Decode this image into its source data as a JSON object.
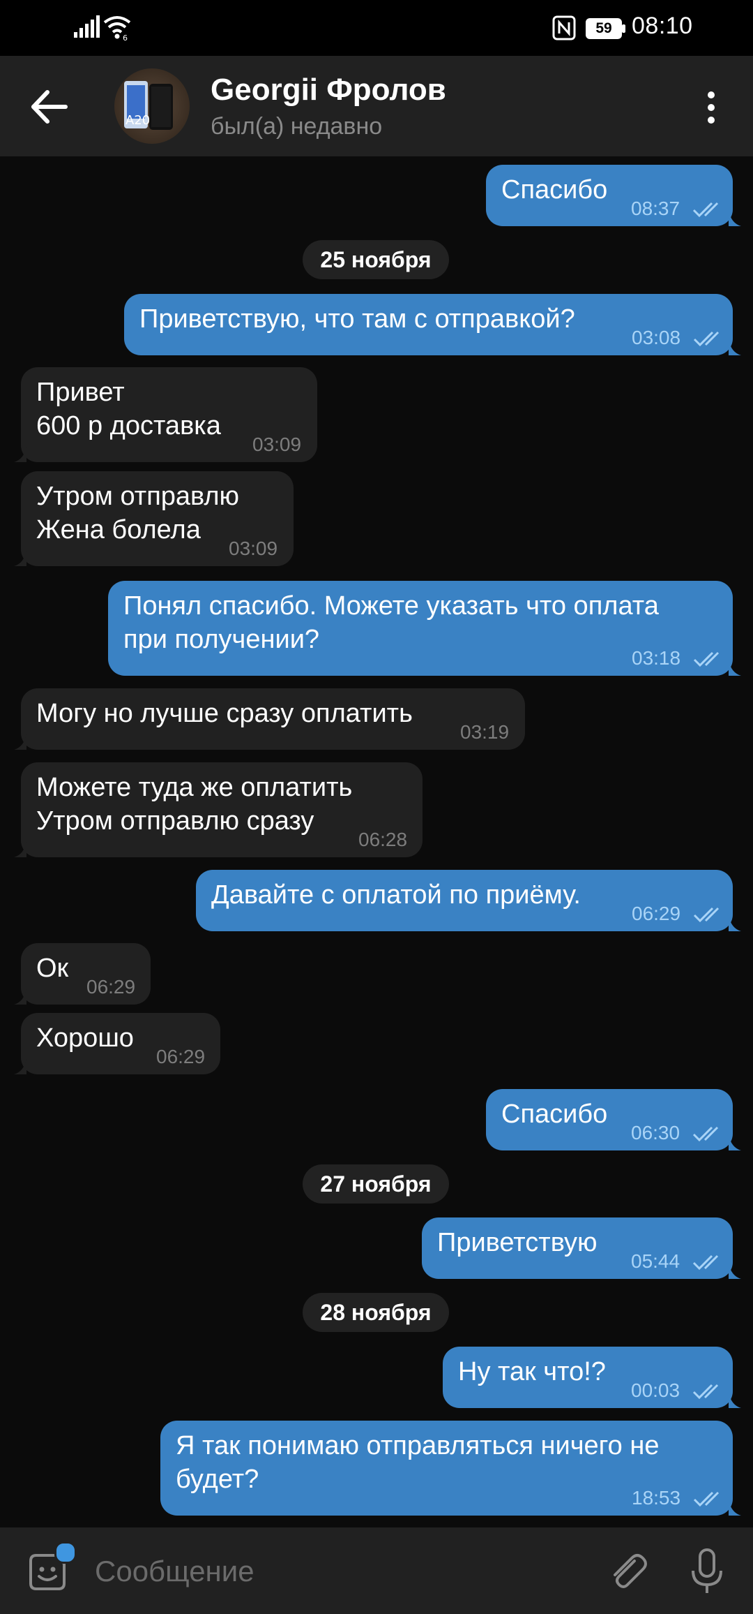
{
  "status_bar": {
    "time": "08:10",
    "battery": "59"
  },
  "header": {
    "contact_name": "Georgii Фролов",
    "contact_status": "был(а) недавно",
    "avatar_text": "A20"
  },
  "messages": [
    {
      "direction": "out",
      "text": "Спасибо",
      "time": "08:37",
      "read": true
    },
    {
      "type": "date",
      "text": "25 ноября"
    },
    {
      "direction": "out",
      "text": "Приветствую, что там с отправкой?",
      "time": "03:08",
      "read": true
    },
    {
      "direction": "in",
      "text": "Привет\n600 р доставка",
      "time": "03:09"
    },
    {
      "direction": "in",
      "text": "Утром отправлю\nЖена болела",
      "time": "03:09"
    },
    {
      "direction": "out",
      "text": "Понял спасибо. Можете указать что оплата\nпри получении?",
      "time": "03:18",
      "read": true
    },
    {
      "direction": "in",
      "text": "Могу но лучше сразу оплатить",
      "time": "03:19"
    },
    {
      "direction": "in",
      "text": "Можете туда же оплатить\nУтром отправлю сразу",
      "time": "06:28"
    },
    {
      "direction": "out",
      "text": "Давайте с оплатой по приёму.",
      "time": "06:29",
      "read": true
    },
    {
      "direction": "in",
      "text": "Ок",
      "time": "06:29"
    },
    {
      "direction": "in",
      "text": "Хорошо",
      "time": "06:29"
    },
    {
      "direction": "out",
      "text": "Спасибо",
      "time": "06:30",
      "read": true
    },
    {
      "type": "date",
      "text": "27 ноября"
    },
    {
      "direction": "out",
      "text": "Приветствую",
      "time": "05:44",
      "read": true
    },
    {
      "type": "date",
      "text": "28 ноября"
    },
    {
      "direction": "out",
      "text": "Ну так что!?",
      "time": "00:03",
      "read": true
    },
    {
      "direction": "out",
      "text": "Я так понимаю отправляться ничего не\nбудет?",
      "time": "18:53",
      "read": true
    }
  ],
  "input": {
    "placeholder": "Сообщение",
    "value": ""
  },
  "colors": {
    "outgoing_bubble": "#3a82c4",
    "incoming_bubble": "#212121",
    "header_bg": "#212121",
    "chat_bg": "#0b0b0b",
    "accent": "#3f96e0"
  }
}
